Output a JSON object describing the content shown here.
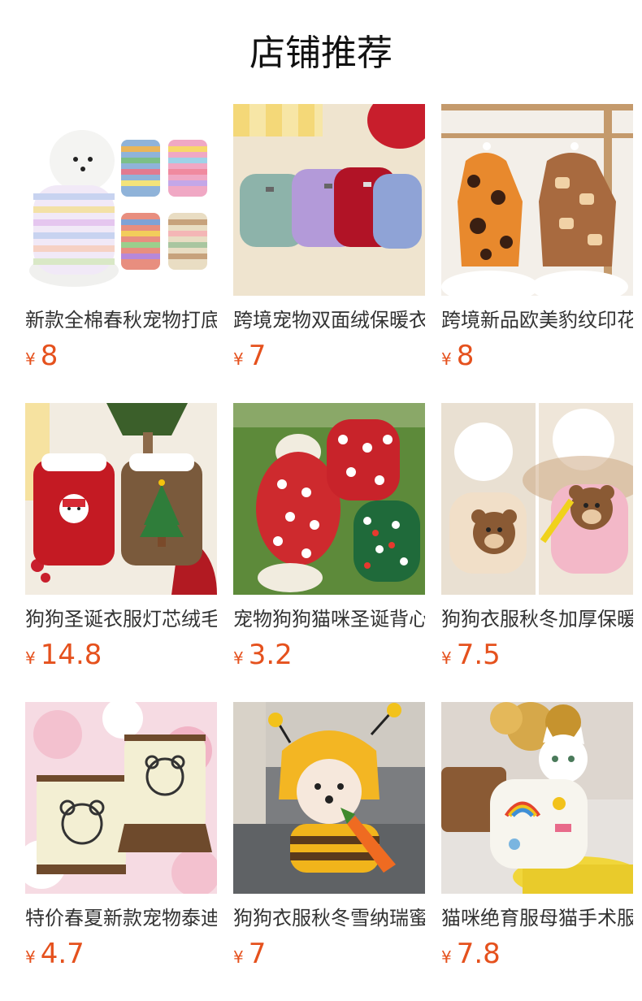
{
  "header": {
    "title": "店铺推荐"
  },
  "currency_symbol": "¥",
  "products": [
    {
      "name": "新款全棉春秋宠物打底衫",
      "price": "8",
      "image_icon": "striped-dog-sweater-image"
    },
    {
      "name": "跨境宠物双面绒保暖衣服",
      "price": "7",
      "image_icon": "fleece-pet-sweater-image"
    },
    {
      "name": "跨境新品欧美豹纹印花",
      "price": "8",
      "image_icon": "leopard-print-hoodie-image"
    },
    {
      "name": "狗狗圣诞衣服灯芯绒毛领",
      "price": "14.8",
      "image_icon": "christmas-corduroy-coat-image"
    },
    {
      "name": "宠物狗狗猫咪圣诞背心",
      "price": "3.2",
      "image_icon": "christmas-pet-vest-image"
    },
    {
      "name": "狗狗衣服秋冬加厚保暖",
      "price": "7.5",
      "image_icon": "bear-fleece-coat-image"
    },
    {
      "name": "特价春夏新款宠物泰迪",
      "price": "4.7",
      "image_icon": "bear-print-shirt-image"
    },
    {
      "name": "狗狗衣服秋冬雪纳瑞蜜蜂",
      "price": "7",
      "image_icon": "bee-costume-dog-image"
    },
    {
      "name": "猫咪绝育服母猫手术服",
      "price": "7.8",
      "image_icon": "cat-surgery-suit-image"
    }
  ],
  "colors": {
    "price": "#e5511d",
    "title": "#111111",
    "text": "#333333"
  }
}
